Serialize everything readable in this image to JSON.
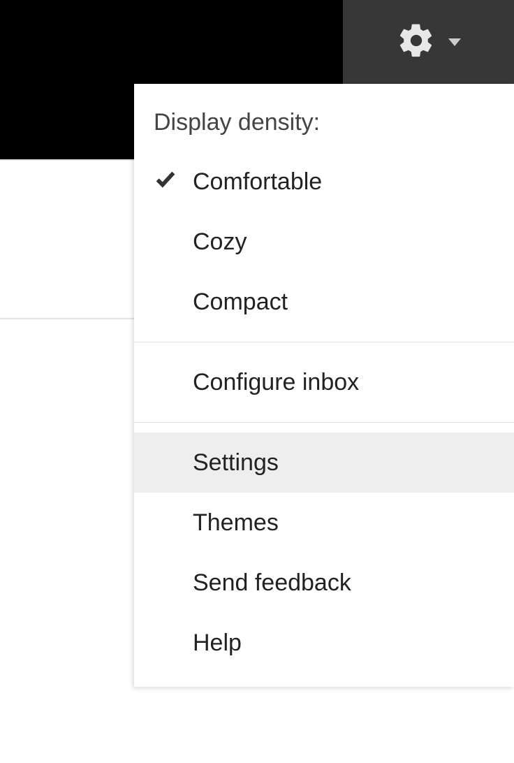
{
  "menu": {
    "header": "Display density:",
    "density_options": [
      {
        "label": "Comfortable",
        "selected": true
      },
      {
        "label": "Cozy",
        "selected": false
      },
      {
        "label": "Compact",
        "selected": false
      }
    ],
    "configure_inbox": "Configure inbox",
    "settings": "Settings",
    "themes": "Themes",
    "send_feedback": "Send feedback",
    "help": "Help"
  }
}
